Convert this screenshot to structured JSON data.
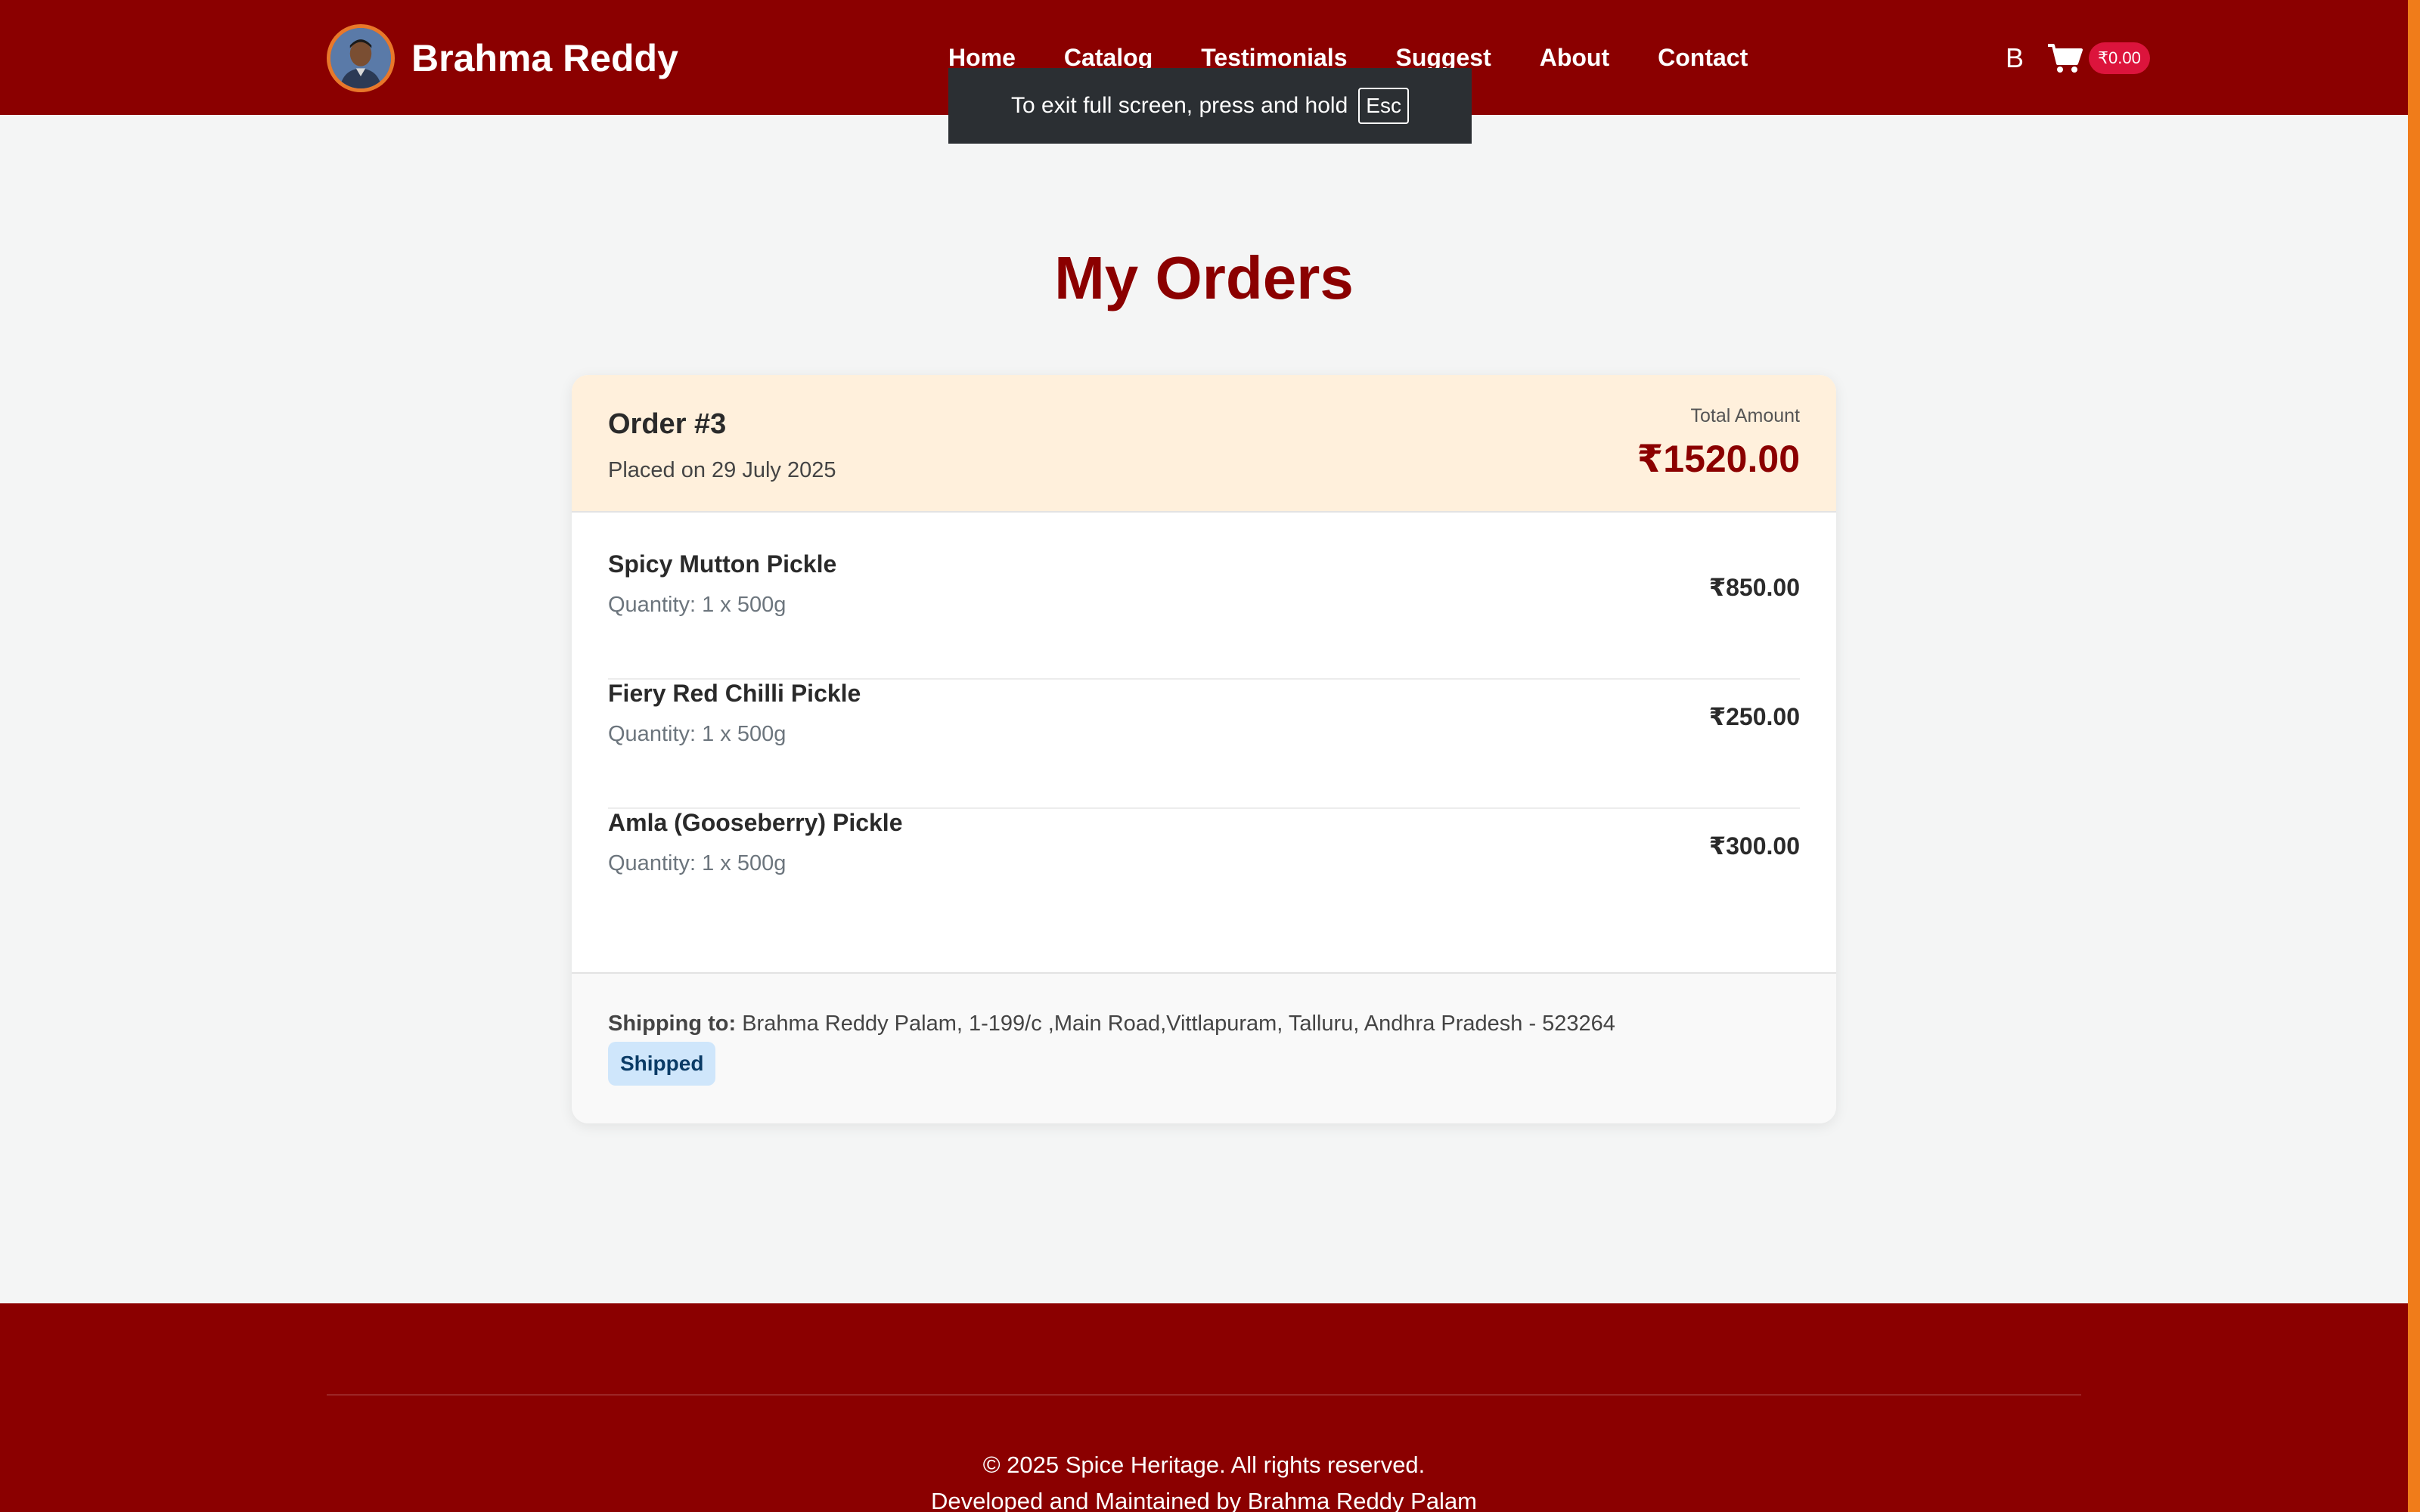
{
  "header": {
    "brand_name": "Brahma Reddy",
    "nav": [
      "Home",
      "Catalog",
      "Testimonials",
      "Suggest",
      "About",
      "Contact"
    ],
    "user_initial": "B",
    "cart_total": "₹0.00",
    "icons": {
      "cart": "cart-icon",
      "avatar": "avatar"
    }
  },
  "fullscreen_notice": {
    "text": "To exit full screen, press and hold",
    "key": "Esc"
  },
  "page": {
    "title": "My Orders"
  },
  "order": {
    "number": "Order #3",
    "placed": "Placed on 29 July 2025",
    "total_label": "Total Amount",
    "total_value": "₹1520.00",
    "items": [
      {
        "name": "Spicy Mutton Pickle",
        "quantity": "Quantity: 1 x 500g",
        "price": "₹850.00"
      },
      {
        "name": "Fiery Red Chilli Pickle",
        "quantity": "Quantity: 1 x 500g",
        "price": "₹250.00"
      },
      {
        "name": "Amla (Gooseberry) Pickle",
        "quantity": "Quantity: 1 x 500g",
        "price": "₹300.00"
      }
    ],
    "shipping_label": "Shipping to:",
    "shipping_address": "Brahma Reddy Palam, 1-199/c ,Main Road,Vittlapuram, Talluru, Andhra Pradesh - 523264",
    "status": "Shipped"
  },
  "footer": {
    "copyright": "© 2025 Spice Heritage. All rights reserved.",
    "developer": "Developed and Maintained by Brahma Reddy Palam"
  },
  "colors": {
    "brand": "#8b0000",
    "accent": "#f07c1a",
    "badge": "#dc143c",
    "status_bg": "#cfe6fb",
    "order_header_bg": "#fff0dc"
  }
}
